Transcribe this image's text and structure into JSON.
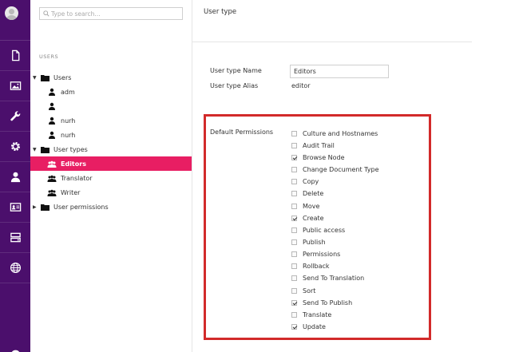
{
  "search": {
    "placeholder": "Type to search..."
  },
  "tree": {
    "section_title": "USERS",
    "nodes": [
      {
        "label": "Users"
      },
      {
        "label": "adm"
      },
      {
        "label": ""
      },
      {
        "label": "nurh"
      },
      {
        "label": "nurh"
      },
      {
        "label": "User types"
      },
      {
        "label": "Editors"
      },
      {
        "label": "Translator"
      },
      {
        "label": "Writer"
      },
      {
        "label": "User permissions"
      }
    ]
  },
  "header": {
    "title": "User type"
  },
  "form": {
    "name_label": "User type Name",
    "name_value": "Editors",
    "alias_label": "User type Alias",
    "alias_value": "editor",
    "permissions_label": "Default Permissions"
  },
  "permissions": [
    {
      "label": "Culture and Hostnames",
      "checked": false
    },
    {
      "label": "Audit Trail",
      "checked": false
    },
    {
      "label": "Browse Node",
      "checked": true
    },
    {
      "label": "Change Document Type",
      "checked": false
    },
    {
      "label": "Copy",
      "checked": false
    },
    {
      "label": "Delete",
      "checked": false
    },
    {
      "label": "Move",
      "checked": false
    },
    {
      "label": "Create",
      "checked": true
    },
    {
      "label": "Public access",
      "checked": false
    },
    {
      "label": "Publish",
      "checked": false
    },
    {
      "label": "Permissions",
      "checked": false
    },
    {
      "label": "Rollback",
      "checked": false
    },
    {
      "label": "Send To Translation",
      "checked": false
    },
    {
      "label": "Sort",
      "checked": false
    },
    {
      "label": "Send To Publish",
      "checked": true
    },
    {
      "label": "Translate",
      "checked": false
    },
    {
      "label": "Update",
      "checked": true
    }
  ],
  "colors": {
    "rail": "#4b0f6c",
    "selected": "#e81e63",
    "highlight_border": "#d22a2a"
  }
}
